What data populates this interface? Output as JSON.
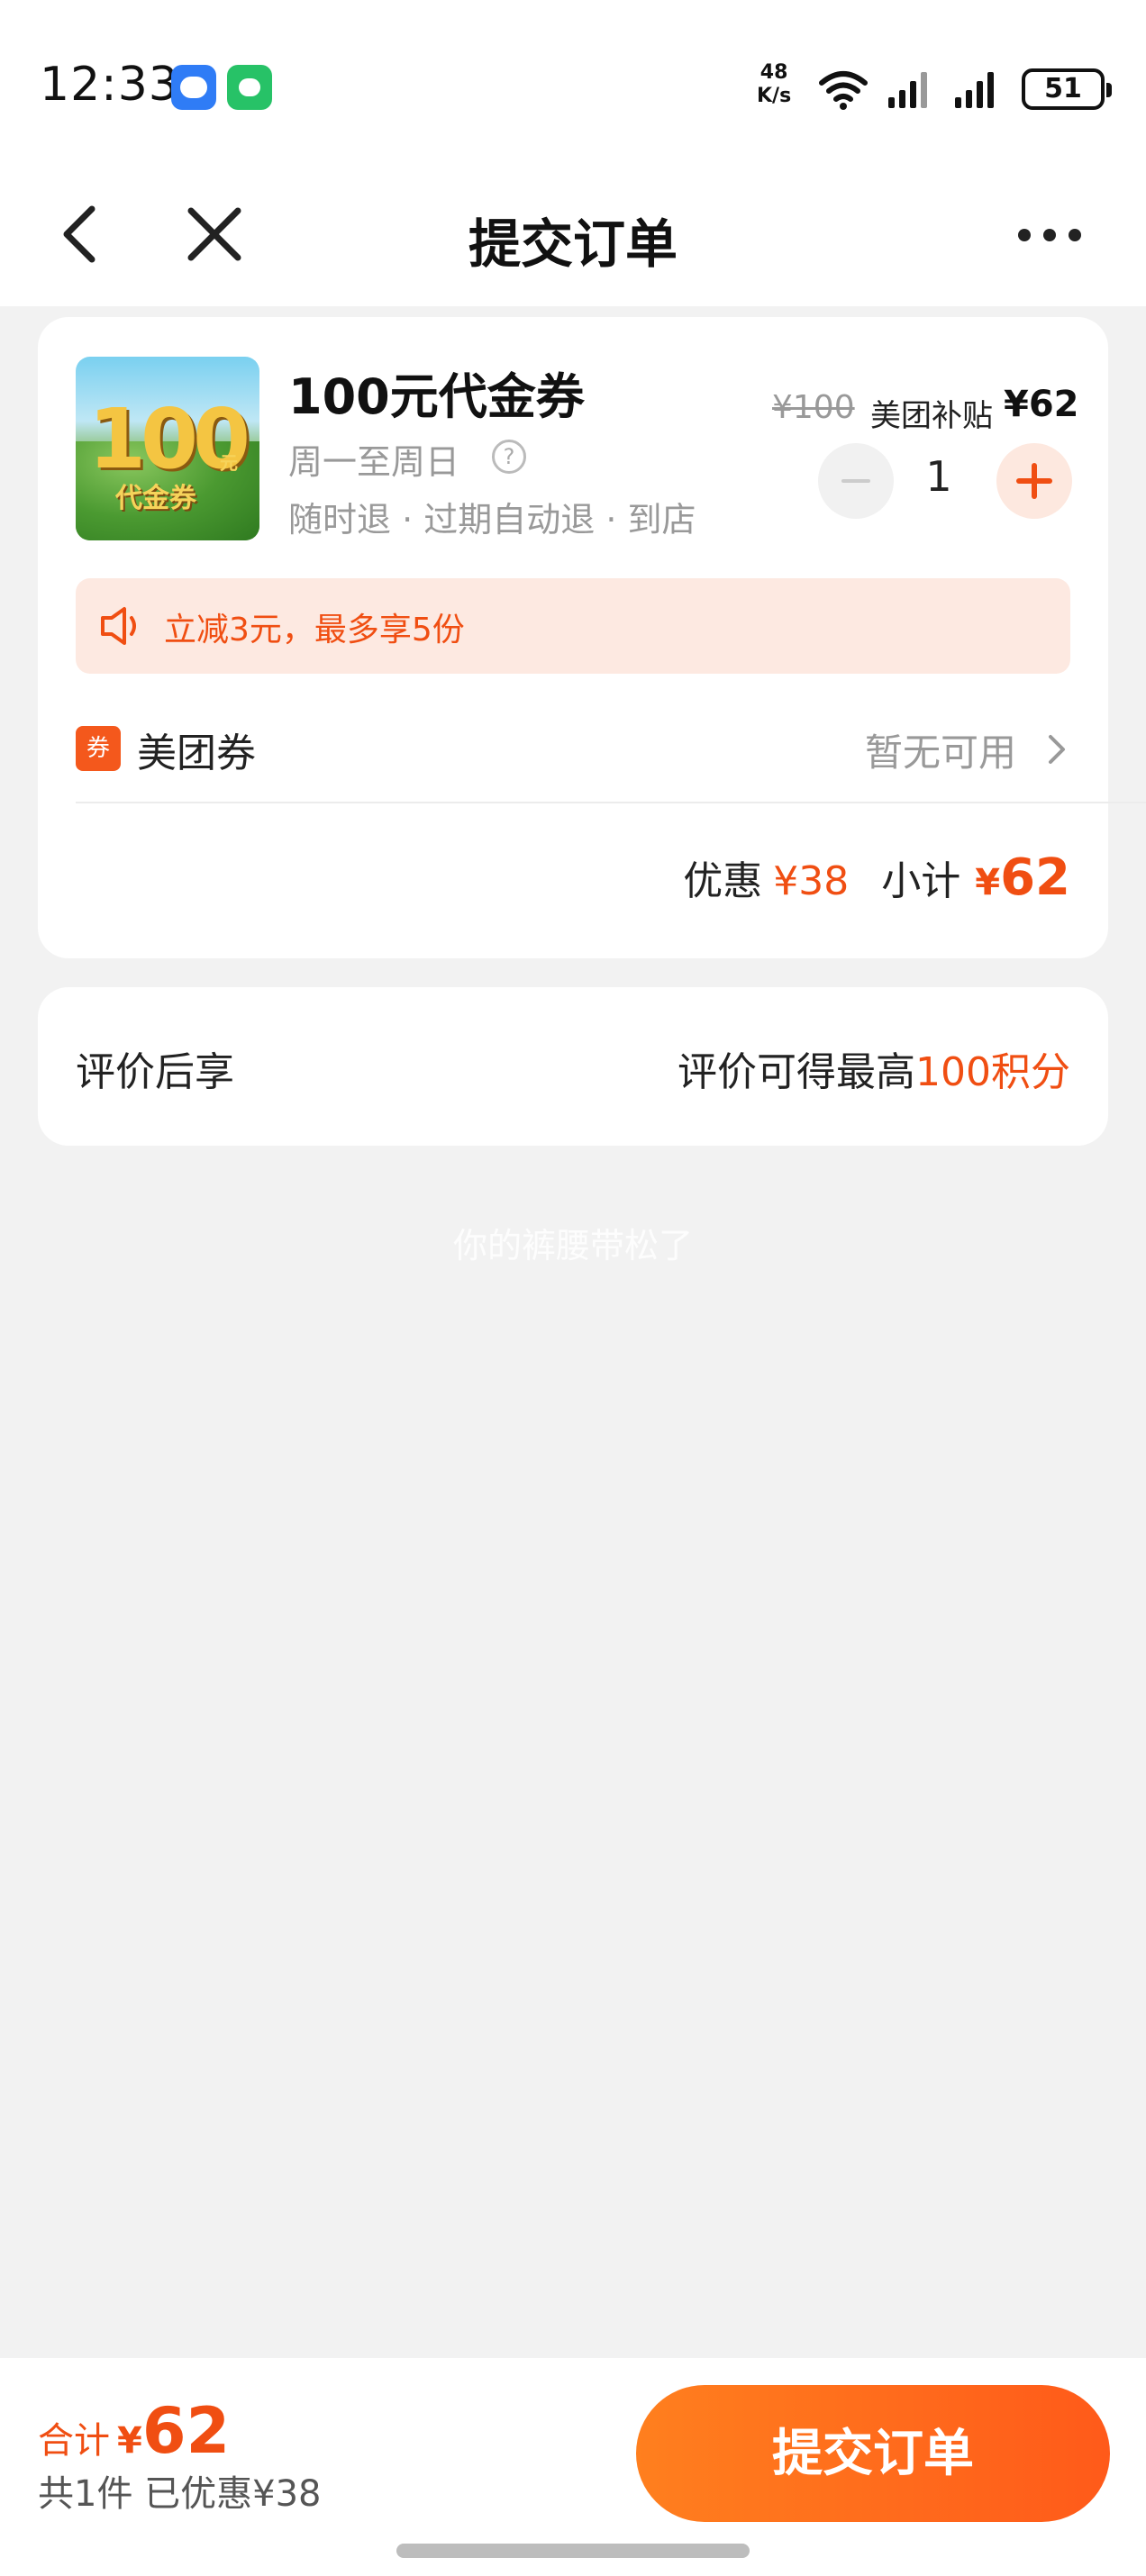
{
  "status_bar": {
    "time": "12:33",
    "net_speed_value": "48",
    "net_speed_unit": "K/s",
    "battery": "51"
  },
  "nav": {
    "title": "提交订单"
  },
  "product": {
    "image_big_text": "100",
    "image_yuan_text": "元",
    "image_sub_text": "代金券",
    "title": "100元代金券",
    "valid_days": "周一至周日",
    "help_glyph": "?",
    "rules": "随时退 · 过期自动退 · 到店",
    "original_price": "¥100",
    "subsidy_label": "美团补贴",
    "sale_price": "¥62",
    "quantity": "1"
  },
  "promo": {
    "text": "立减3元，最多享5份"
  },
  "coupon": {
    "badge": "券",
    "label": "美团券",
    "value": "暂无可用"
  },
  "summary": {
    "discount_label": "优惠",
    "discount_value": "¥38",
    "subtotal_label": "小计",
    "subtotal_currency": "¥",
    "subtotal_value": "62"
  },
  "review": {
    "left_label": "评价后享",
    "right_prefix": "评价可得最高",
    "right_highlight": "100积分"
  },
  "watermark": "你的裤腰带松了",
  "bottom_bar": {
    "total_label": "合计",
    "total_currency": "¥",
    "total_value": "62",
    "count_text": "共1件  已优惠¥38",
    "submit_label": "提交订单"
  },
  "colors": {
    "accent": "#f04e12",
    "button_gradient_start": "#ff7f1e",
    "button_gradient_end": "#ff5a1a",
    "page_bg": "#f2f2f2"
  }
}
